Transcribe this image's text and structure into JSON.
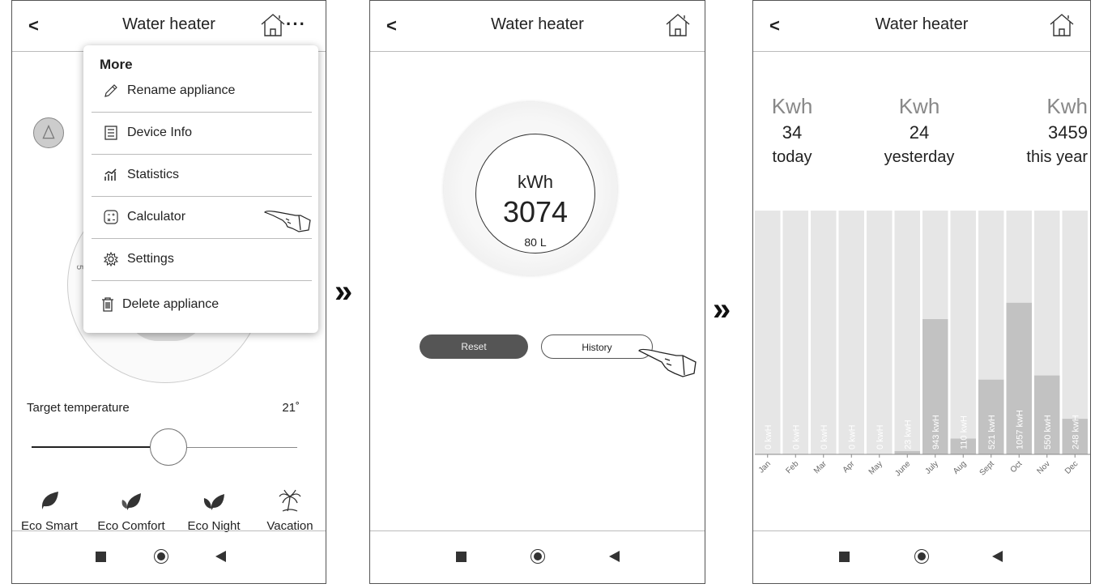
{
  "phone1": {
    "header": {
      "back_icon": "chevron-left",
      "title": "Water heater",
      "home_icon": "home-icon",
      "more_icon": "more-icon"
    },
    "dial_tick": "5",
    "menu": {
      "heading": "More",
      "items": [
        {
          "icon": "pencil-icon",
          "label": "Rename appliance"
        },
        {
          "icon": "device-info-icon",
          "label": "Device Info"
        },
        {
          "icon": "statistics-icon",
          "label": "Statistics"
        },
        {
          "icon": "calculator-icon",
          "label": "Calculator"
        },
        {
          "icon": "gear-icon",
          "label": "Settings"
        },
        {
          "icon": "trash-icon",
          "label": "Delete appliance"
        }
      ]
    },
    "target": {
      "label": "Target temperature",
      "value": "21˚",
      "slider_fraction": 0.5
    },
    "modes": [
      {
        "icon": "leaf-icon",
        "label": "Eco Smart"
      },
      {
        "icon": "leaves-icon",
        "label": "Eco Comfort"
      },
      {
        "icon": "leaves-night-icon",
        "label": "Eco Night"
      },
      {
        "icon": "palm-tree-icon",
        "label": "Vacation"
      }
    ]
  },
  "phone2": {
    "header": {
      "title": "Water heater"
    },
    "gauge": {
      "unit": "kWh",
      "value": "3074",
      "capacity": "80 L"
    },
    "buttons": {
      "reset": "Reset",
      "history": "History"
    }
  },
  "phone3": {
    "header": {
      "title": "Water heater"
    },
    "stats": [
      {
        "unit": "Kwh",
        "value": "34",
        "caption": "today"
      },
      {
        "unit": "Kwh",
        "value": "24",
        "caption": "yesterday"
      },
      {
        "unit": "Kwh",
        "value": "3459",
        "caption": "this year"
      }
    ]
  },
  "chart_data": {
    "type": "bar",
    "categories": [
      "Jan",
      "Feb",
      "Mar",
      "Apr",
      "May",
      "June",
      "July",
      "Aug",
      "Sept",
      "Oct",
      "Nov",
      "Dec"
    ],
    "values": [
      0,
      0,
      0,
      0,
      0,
      23,
      943,
      110,
      521,
      1057,
      550,
      248
    ],
    "data_labels": [
      "0 kwH",
      "0 kwH",
      "0 kwH",
      "0 kwH",
      "0 kwH",
      "23 kwH",
      "943 kwH",
      "110 kwH",
      "521 kwH",
      "1057 kwH",
      "550 kwH",
      "248 kwH"
    ],
    "ylim": [
      0,
      1700
    ],
    "colors": {
      "track": "#e6e6e6",
      "fill": "#c2c2c2",
      "label": "#ffffff",
      "axis": "#888888"
    }
  },
  "arrows": [
    "»",
    "»"
  ]
}
